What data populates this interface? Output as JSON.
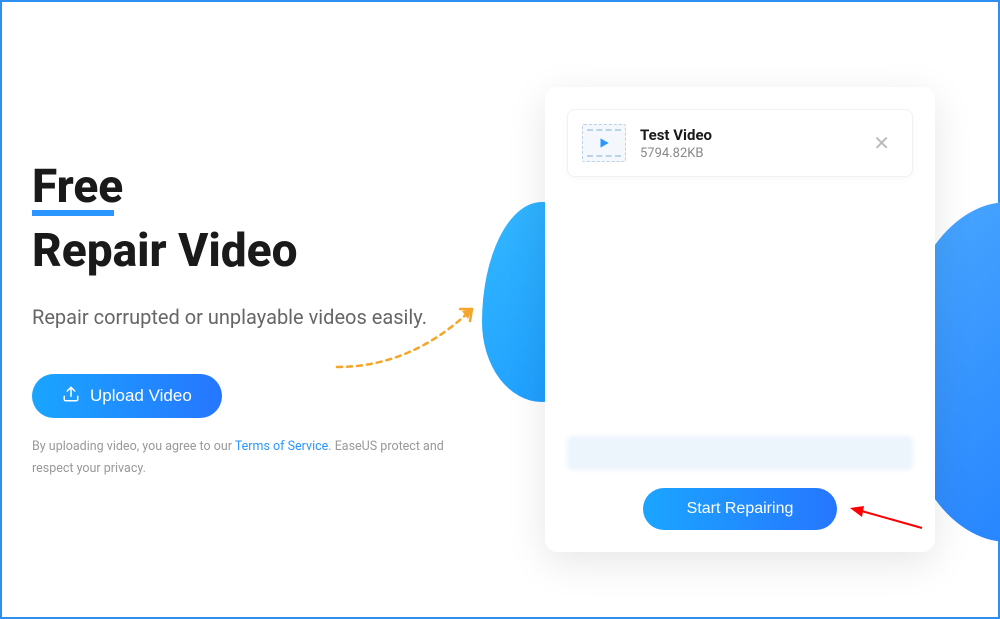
{
  "left": {
    "title_free": "Free",
    "title_repair": "Repair Video",
    "subtitle": "Repair corrupted or unplayable videos easily.",
    "upload_label": "Upload Video",
    "agree_prefix": "By uploading video, you agree to our ",
    "agree_link": "Terms of Service",
    "agree_suffix": ". EaseUS protect and respect your privacy."
  },
  "card": {
    "file": {
      "name": "Test Video",
      "size": "5794.82KB"
    },
    "repair_label": "Start Repairing"
  }
}
